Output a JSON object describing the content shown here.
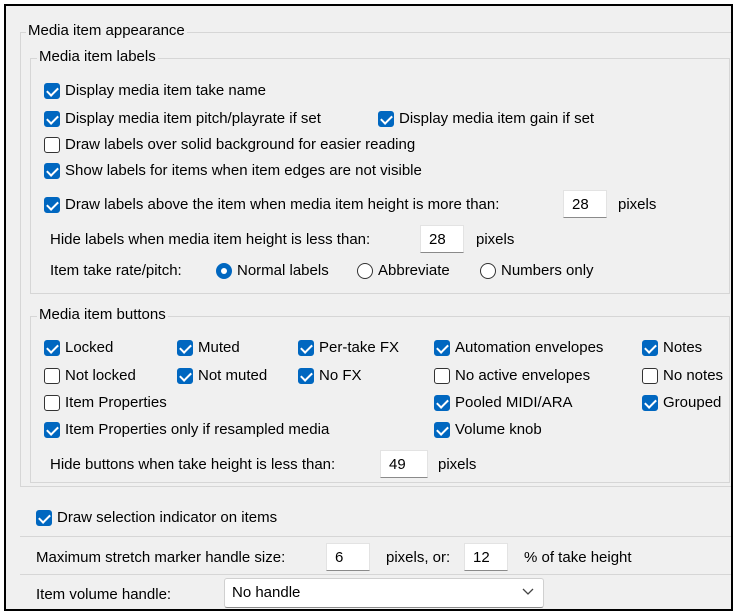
{
  "appearance": {
    "title": "Media item appearance",
    "labels_group": {
      "title": "Media item labels",
      "display_take_name": "Display media item take name",
      "display_pitch": "Display media item pitch/playrate if set",
      "display_gain": "Display media item gain if set",
      "solid_background": "Draw labels over solid background for easier reading",
      "show_labels_edges": "Show labels for items when item edges are not visible",
      "draw_above": "Draw labels above the item when media item height is more than:",
      "draw_above_value": "28",
      "draw_above_unit": "pixels",
      "hide_labels": "Hide labels when media item height is less than:",
      "hide_labels_value": "28",
      "hide_labels_unit": "pixels",
      "rate_pitch_label": "Item take rate/pitch:",
      "radio_normal": "Normal labels",
      "radio_abbreviate": "Abbreviate",
      "radio_numbers": "Numbers only",
      "rate_pitch_selected": "Normal labels"
    },
    "buttons_group": {
      "title": "Media item buttons",
      "locked": "Locked",
      "muted": "Muted",
      "per_take_fx": "Per-take FX",
      "automation_envelopes": "Automation envelopes",
      "notes": "Notes",
      "not_locked": "Not locked",
      "not_muted": "Not muted",
      "no_fx": "No FX",
      "no_active_envelopes": "No active envelopes",
      "no_notes": "No notes",
      "item_properties": "Item Properties",
      "pooled_midi": "Pooled MIDI/ARA",
      "grouped": "Grouped",
      "item_properties_resampled": "Item Properties only if resampled media",
      "volume_knob": "Volume knob",
      "hide_buttons": "Hide buttons when take height is less than:",
      "hide_buttons_value": "49",
      "hide_buttons_unit": "pixels"
    },
    "draw_selection_indicator": "Draw selection indicator on items",
    "stretch_marker": {
      "label": "Maximum stretch marker handle size:",
      "pixels_value": "6",
      "pixels_or": "pixels, or:",
      "percent_value": "12",
      "percent_unit": "% of take height"
    },
    "volume_handle": {
      "label": "Item volume handle:",
      "selected": "No handle"
    }
  },
  "colors": {
    "accent": "#0067c0",
    "background": "#f0f0f0"
  }
}
